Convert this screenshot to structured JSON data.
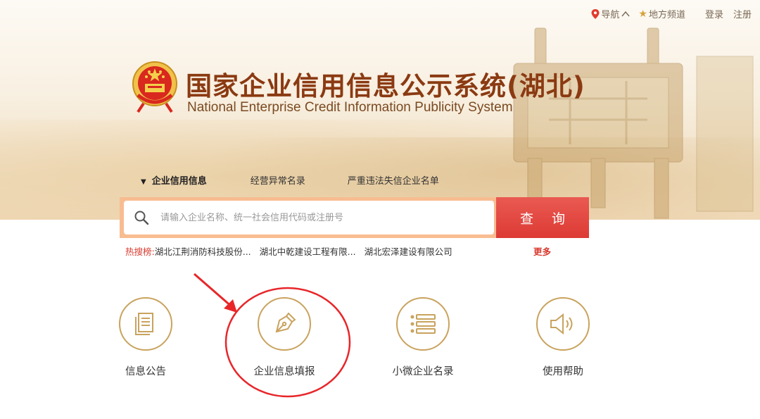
{
  "topbar": {
    "nav_label": "导航",
    "local_channel_label": "地方频道",
    "login_label": "登录",
    "register_label": "注册"
  },
  "header": {
    "title_cn": "国家企业信用信息公示系统(湖北)",
    "title_en": "National Enterprise Credit Information Publicity System"
  },
  "search": {
    "tabs": [
      {
        "label": "企业信用信息",
        "active": true
      },
      {
        "label": "经营异常名录",
        "active": false
      },
      {
        "label": "严重违法失信企业名单",
        "active": false
      }
    ],
    "placeholder": "请输入企业名称、统一社会信用代码或注册号",
    "button_label": "查 询"
  },
  "hot_search": {
    "label": "热搜榜:",
    "items": [
      "湖北江荆消防科技股份...",
      "湖北中乾建设工程有限...",
      "湖北宏泽建设有限公司"
    ],
    "more_label": "更多"
  },
  "features": [
    {
      "label": "信息公告",
      "icon": "document-icon"
    },
    {
      "label": "企业信息填报",
      "icon": "pen-nib-icon"
    },
    {
      "label": "小微企业名录",
      "icon": "list-icon"
    },
    {
      "label": "使用帮助",
      "icon": "speaker-icon"
    }
  ],
  "colors": {
    "accent_gold": "#c9a35e",
    "title_brown": "#8b3a12",
    "search_red": "#dd3a34",
    "annotation_red": "#e8262a",
    "hot_red": "#d9392e"
  }
}
